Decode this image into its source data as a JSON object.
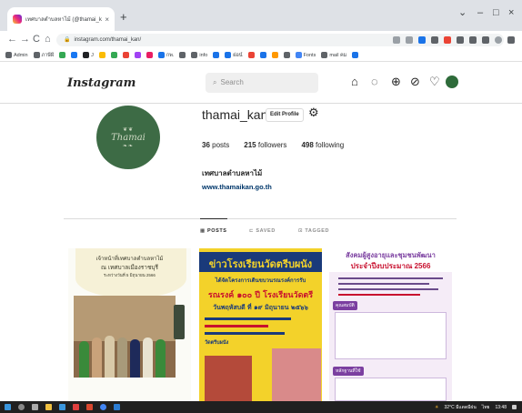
{
  "browser": {
    "tab_title": "เทศบาลตำบลหาไม้ (@thamai_kan) • Instagram",
    "tab_close": "×",
    "new_tab": "+",
    "window_controls": [
      "⌄",
      "–",
      "□",
      "×"
    ],
    "nav": [
      "←",
      "→",
      "C",
      "⌂"
    ],
    "url": "instagram.com/thamai_kan/",
    "bookmarks": [
      {
        "label": "Admin",
        "color": "#5f6368"
      },
      {
        "label": "ภาษีผี",
        "color": "#5f6368"
      },
      {
        "label": "",
        "color": "#34a853"
      },
      {
        "label": "",
        "color": "#1877f2"
      },
      {
        "label": "J",
        "color": "#202124"
      },
      {
        "label": "",
        "color": "#fbbc04"
      },
      {
        "label": "",
        "color": "#34a853"
      },
      {
        "label": "",
        "color": "#ea4335"
      },
      {
        "label": "",
        "color": "#a142f4"
      },
      {
        "label": "",
        "color": "#e91e63"
      },
      {
        "label": "กพ.",
        "color": "#1a73e8"
      },
      {
        "label": "",
        "color": "#5f6368"
      },
      {
        "label": "info",
        "color": "#5f6368"
      },
      {
        "label": "",
        "color": "#1a73e8"
      },
      {
        "label": "ฝอน์",
        "color": "#1a73e8"
      },
      {
        "label": "",
        "color": "#ea4335"
      },
      {
        "label": "",
        "color": "#1a73e8"
      },
      {
        "label": "",
        "color": "#ff9800"
      },
      {
        "label": "",
        "color": "#5f6368"
      },
      {
        "label": "Fonts",
        "color": "#4285f4"
      },
      {
        "label": "mail คม",
        "color": "#5f6368"
      },
      {
        "label": "",
        "color": "#1a73e8"
      }
    ]
  },
  "instagram": {
    "logo": "Instagram",
    "search_placeholder": "Search",
    "nav_icons": [
      "home-icon",
      "messenger-icon",
      "new-post-icon",
      "explore-icon",
      "heart-icon",
      "profile-avatar"
    ],
    "profile": {
      "username": "thamai_kan",
      "edit_label": "Edit Profile",
      "posts": "36",
      "posts_label": "posts",
      "followers": "215",
      "followers_label": "followers",
      "following": "498",
      "following_label": "following",
      "full_name": "เทศบาลตำบลหาไม้",
      "website": "www.thamaikan.go.th",
      "pic_text": "Thamai"
    },
    "tabs": [
      {
        "label": "POSTS",
        "icon": "▦"
      },
      {
        "label": "SAVED",
        "icon": "⊏"
      },
      {
        "label": "TAGGED",
        "icon": "⊡"
      }
    ],
    "posts": [
      {
        "line1": "เจ้าหน้าที่เทศบาลตำบลหาไม้",
        "line2": "ณ เทศบาลเมืองราชบุรี",
        "line3": "ระหว่างวันที่ 5 มิถุนายน 2566"
      },
      {
        "line1": "ข่าวโรงเรียนวัดตรีบผนัง",
        "line2": "ได้จัดโครงการเดินขบวนรณรงค์การรับ",
        "line3": "รณรงค์ ๑๐๐ ปี โรงเรียนวัดตรี",
        "line4": "วันพฤหัสบดี ที่ ๑๙ มิถุนายน ๒๕๖๖",
        "line5": "วัดตรีบผนัง"
      },
      {
        "title1": "สังคมผู้สูงอายุและชุมชนพัฒนา",
        "title2": "ประจำปีงบประมาณ 2566",
        "badge1": "คุณสมบัติ",
        "badge2": "หลักฐานที่ใช้"
      }
    ]
  },
  "taskbar": {
    "weather": "32°C มีแดดมีฝน",
    "time": "13:48",
    "lang": "ไทย"
  }
}
